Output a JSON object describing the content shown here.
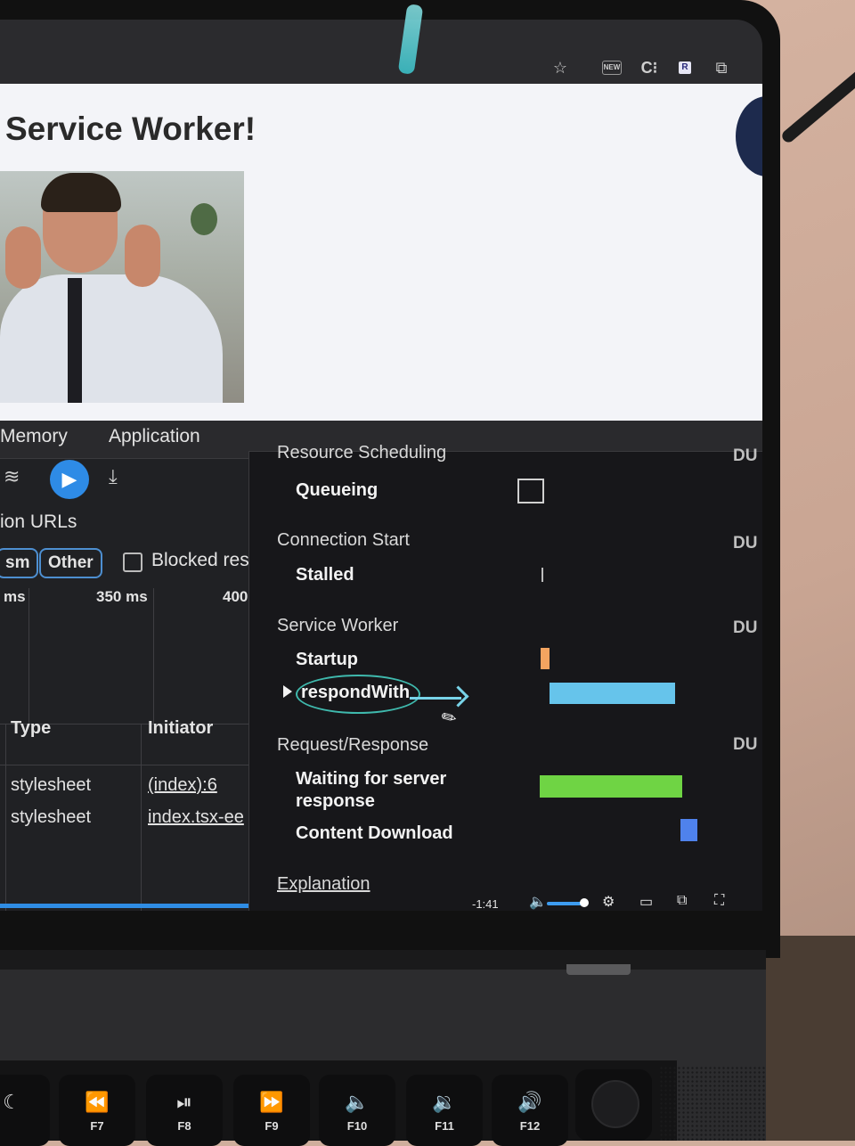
{
  "page": {
    "title": "Service Worker!"
  },
  "browser_toolbar": {
    "icons": [
      "star-icon",
      "new-badge-icon",
      "c-extension-icon",
      "r-extension-icon",
      "puzzle-icon"
    ],
    "new_badge": "NEW",
    "r_badge": "R"
  },
  "devtools": {
    "tabs": [
      "Memory",
      "Application"
    ],
    "filter_label": "ion URLs",
    "chips": [
      "sm",
      "Other"
    ],
    "blocked_label": "Blocked res",
    "ticks": [
      "ms",
      "350 ms",
      "400"
    ],
    "table": {
      "headers": [
        "Type",
        "Initiator"
      ],
      "rows": [
        {
          "type": "stylesheet",
          "initiator": "(index):6"
        },
        {
          "type": "stylesheet",
          "initiator": "index.tsx-ee"
        }
      ]
    },
    "timing": {
      "sections": {
        "resource_scheduling": "Resource Scheduling",
        "connection_start": "Connection Start",
        "service_worker": "Service Worker",
        "request_response": "Request/Response"
      },
      "items": {
        "queueing": "Queueing",
        "stalled": "Stalled",
        "startup": "Startup",
        "respond_with": "respondWith",
        "waiting": "Waiting for server response",
        "content_download": "Content Download"
      },
      "du": "DU",
      "explanation": "Explanation",
      "colors": {
        "startup": "#f4a460",
        "respond_with": "#66c4eb",
        "waiting": "#6fd444",
        "content_download": "#4f82ec"
      }
    },
    "media_time": "-1:41"
  },
  "keyboard": {
    "keys": [
      "F7",
      "F8",
      "F9",
      "F10",
      "F11",
      "F12"
    ]
  }
}
